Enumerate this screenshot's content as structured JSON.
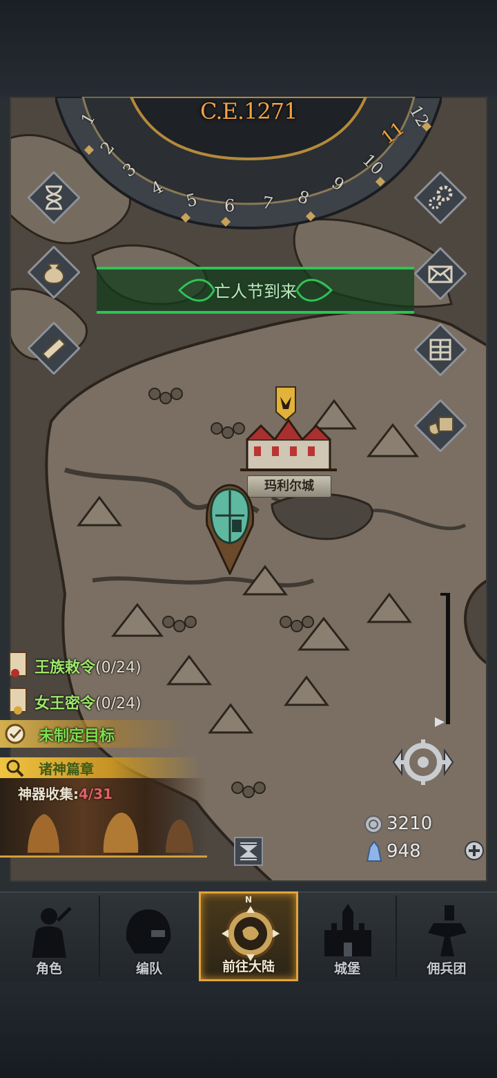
{
  "calendar": {
    "year": "C.E.1271",
    "months": [
      "1",
      "2",
      "3",
      "4",
      "5",
      "6",
      "7",
      "8",
      "9",
      "10",
      "11",
      "12"
    ],
    "current_month": "11"
  },
  "event": {
    "title": "亡人节到来"
  },
  "map": {
    "city_name": "玛利尔城",
    "icons": {
      "city": "castle-icon",
      "player": "helmet-marker-icon",
      "banner": "crest-banner-icon"
    }
  },
  "side_buttons": {
    "left": [
      "hourglass-icon",
      "money-bag-icon",
      "scroll-icon"
    ],
    "right": [
      "gear-icon",
      "mail-icon",
      "gate-icon",
      "supply-crate-icon"
    ]
  },
  "quests": [
    {
      "name": "王族敕令",
      "count": "(0/24)",
      "icon": "decree-scroll-icon"
    },
    {
      "name": "女王密令",
      "count": "(0/24)",
      "icon": "queen-scroll-icon"
    }
  ],
  "goal": {
    "label": "未制定目标",
    "icon": "target-icon"
  },
  "gods": {
    "label": "诸神篇章",
    "icon": "magnifier-icon"
  },
  "artifacts": {
    "label": "神器收集",
    "separator": ":",
    "count": "4/31"
  },
  "resources": {
    "silver": {
      "value": "3210",
      "icon": "silver-coin-icon"
    },
    "crystal": {
      "value": "948",
      "icon": "crystal-icon"
    }
  },
  "nav": [
    {
      "label": "角色",
      "icon": "knight-icon",
      "active": false
    },
    {
      "label": "编队",
      "icon": "helmet-icon",
      "active": false
    },
    {
      "label": "前往大陆",
      "icon": "compass-icon",
      "active": true
    },
    {
      "label": "城堡",
      "icon": "castle-icon",
      "active": false
    },
    {
      "label": "佣兵团",
      "icon": "mercenary-icon",
      "active": false
    }
  ],
  "compass_letter": "N",
  "colors": {
    "accent": "#e2a53c",
    "quest_green": "#9ee66b",
    "event_green": "#2ec456",
    "map_parchment": "#6b6155"
  }
}
